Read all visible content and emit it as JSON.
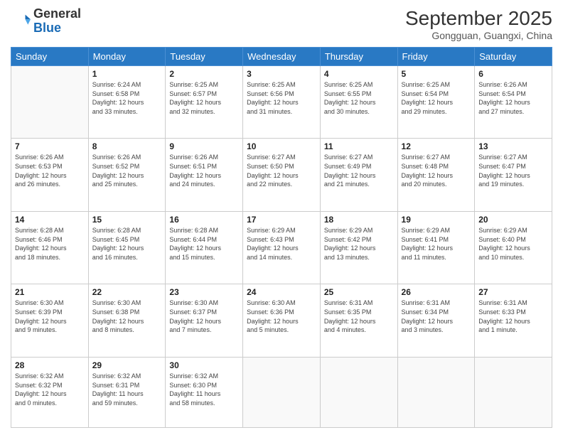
{
  "header": {
    "logo_general": "General",
    "logo_blue": "Blue",
    "month_year": "September 2025",
    "location": "Gongguan, Guangxi, China"
  },
  "weekdays": [
    "Sunday",
    "Monday",
    "Tuesday",
    "Wednesday",
    "Thursday",
    "Friday",
    "Saturday"
  ],
  "weeks": [
    [
      {
        "day": "",
        "info": ""
      },
      {
        "day": "1",
        "info": "Sunrise: 6:24 AM\nSunset: 6:58 PM\nDaylight: 12 hours\nand 33 minutes."
      },
      {
        "day": "2",
        "info": "Sunrise: 6:25 AM\nSunset: 6:57 PM\nDaylight: 12 hours\nand 32 minutes."
      },
      {
        "day": "3",
        "info": "Sunrise: 6:25 AM\nSunset: 6:56 PM\nDaylight: 12 hours\nand 31 minutes."
      },
      {
        "day": "4",
        "info": "Sunrise: 6:25 AM\nSunset: 6:55 PM\nDaylight: 12 hours\nand 30 minutes."
      },
      {
        "day": "5",
        "info": "Sunrise: 6:25 AM\nSunset: 6:54 PM\nDaylight: 12 hours\nand 29 minutes."
      },
      {
        "day": "6",
        "info": "Sunrise: 6:26 AM\nSunset: 6:54 PM\nDaylight: 12 hours\nand 27 minutes."
      }
    ],
    [
      {
        "day": "7",
        "info": "Sunrise: 6:26 AM\nSunset: 6:53 PM\nDaylight: 12 hours\nand 26 minutes."
      },
      {
        "day": "8",
        "info": "Sunrise: 6:26 AM\nSunset: 6:52 PM\nDaylight: 12 hours\nand 25 minutes."
      },
      {
        "day": "9",
        "info": "Sunrise: 6:26 AM\nSunset: 6:51 PM\nDaylight: 12 hours\nand 24 minutes."
      },
      {
        "day": "10",
        "info": "Sunrise: 6:27 AM\nSunset: 6:50 PM\nDaylight: 12 hours\nand 22 minutes."
      },
      {
        "day": "11",
        "info": "Sunrise: 6:27 AM\nSunset: 6:49 PM\nDaylight: 12 hours\nand 21 minutes."
      },
      {
        "day": "12",
        "info": "Sunrise: 6:27 AM\nSunset: 6:48 PM\nDaylight: 12 hours\nand 20 minutes."
      },
      {
        "day": "13",
        "info": "Sunrise: 6:27 AM\nSunset: 6:47 PM\nDaylight: 12 hours\nand 19 minutes."
      }
    ],
    [
      {
        "day": "14",
        "info": "Sunrise: 6:28 AM\nSunset: 6:46 PM\nDaylight: 12 hours\nand 18 minutes."
      },
      {
        "day": "15",
        "info": "Sunrise: 6:28 AM\nSunset: 6:45 PM\nDaylight: 12 hours\nand 16 minutes."
      },
      {
        "day": "16",
        "info": "Sunrise: 6:28 AM\nSunset: 6:44 PM\nDaylight: 12 hours\nand 15 minutes."
      },
      {
        "day": "17",
        "info": "Sunrise: 6:29 AM\nSunset: 6:43 PM\nDaylight: 12 hours\nand 14 minutes."
      },
      {
        "day": "18",
        "info": "Sunrise: 6:29 AM\nSunset: 6:42 PM\nDaylight: 12 hours\nand 13 minutes."
      },
      {
        "day": "19",
        "info": "Sunrise: 6:29 AM\nSunset: 6:41 PM\nDaylight: 12 hours\nand 11 minutes."
      },
      {
        "day": "20",
        "info": "Sunrise: 6:29 AM\nSunset: 6:40 PM\nDaylight: 12 hours\nand 10 minutes."
      }
    ],
    [
      {
        "day": "21",
        "info": "Sunrise: 6:30 AM\nSunset: 6:39 PM\nDaylight: 12 hours\nand 9 minutes."
      },
      {
        "day": "22",
        "info": "Sunrise: 6:30 AM\nSunset: 6:38 PM\nDaylight: 12 hours\nand 8 minutes."
      },
      {
        "day": "23",
        "info": "Sunrise: 6:30 AM\nSunset: 6:37 PM\nDaylight: 12 hours\nand 7 minutes."
      },
      {
        "day": "24",
        "info": "Sunrise: 6:30 AM\nSunset: 6:36 PM\nDaylight: 12 hours\nand 5 minutes."
      },
      {
        "day": "25",
        "info": "Sunrise: 6:31 AM\nSunset: 6:35 PM\nDaylight: 12 hours\nand 4 minutes."
      },
      {
        "day": "26",
        "info": "Sunrise: 6:31 AM\nSunset: 6:34 PM\nDaylight: 12 hours\nand 3 minutes."
      },
      {
        "day": "27",
        "info": "Sunrise: 6:31 AM\nSunset: 6:33 PM\nDaylight: 12 hours\nand 1 minute."
      }
    ],
    [
      {
        "day": "28",
        "info": "Sunrise: 6:32 AM\nSunset: 6:32 PM\nDaylight: 12 hours\nand 0 minutes."
      },
      {
        "day": "29",
        "info": "Sunrise: 6:32 AM\nSunset: 6:31 PM\nDaylight: 11 hours\nand 59 minutes."
      },
      {
        "day": "30",
        "info": "Sunrise: 6:32 AM\nSunset: 6:30 PM\nDaylight: 11 hours\nand 58 minutes."
      },
      {
        "day": "",
        "info": ""
      },
      {
        "day": "",
        "info": ""
      },
      {
        "day": "",
        "info": ""
      },
      {
        "day": "",
        "info": ""
      }
    ]
  ]
}
